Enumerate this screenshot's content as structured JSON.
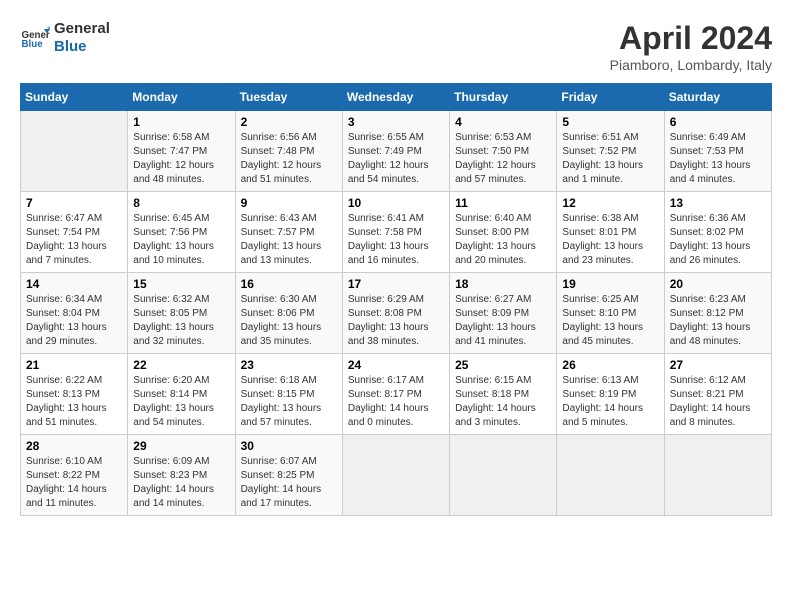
{
  "header": {
    "logo_line1": "General",
    "logo_line2": "Blue",
    "month_title": "April 2024",
    "location": "Piamboro, Lombardy, Italy"
  },
  "calendar": {
    "days_of_week": [
      "Sunday",
      "Monday",
      "Tuesday",
      "Wednesday",
      "Thursday",
      "Friday",
      "Saturday"
    ],
    "weeks": [
      [
        {
          "day": "",
          "info": ""
        },
        {
          "day": "1",
          "info": "Sunrise: 6:58 AM\nSunset: 7:47 PM\nDaylight: 12 hours\nand 48 minutes."
        },
        {
          "day": "2",
          "info": "Sunrise: 6:56 AM\nSunset: 7:48 PM\nDaylight: 12 hours\nand 51 minutes."
        },
        {
          "day": "3",
          "info": "Sunrise: 6:55 AM\nSunset: 7:49 PM\nDaylight: 12 hours\nand 54 minutes."
        },
        {
          "day": "4",
          "info": "Sunrise: 6:53 AM\nSunset: 7:50 PM\nDaylight: 12 hours\nand 57 minutes."
        },
        {
          "day": "5",
          "info": "Sunrise: 6:51 AM\nSunset: 7:52 PM\nDaylight: 13 hours\nand 1 minute."
        },
        {
          "day": "6",
          "info": "Sunrise: 6:49 AM\nSunset: 7:53 PM\nDaylight: 13 hours\nand 4 minutes."
        }
      ],
      [
        {
          "day": "7",
          "info": "Sunrise: 6:47 AM\nSunset: 7:54 PM\nDaylight: 13 hours\nand 7 minutes."
        },
        {
          "day": "8",
          "info": "Sunrise: 6:45 AM\nSunset: 7:56 PM\nDaylight: 13 hours\nand 10 minutes."
        },
        {
          "day": "9",
          "info": "Sunrise: 6:43 AM\nSunset: 7:57 PM\nDaylight: 13 hours\nand 13 minutes."
        },
        {
          "day": "10",
          "info": "Sunrise: 6:41 AM\nSunset: 7:58 PM\nDaylight: 13 hours\nand 16 minutes."
        },
        {
          "day": "11",
          "info": "Sunrise: 6:40 AM\nSunset: 8:00 PM\nDaylight: 13 hours\nand 20 minutes."
        },
        {
          "day": "12",
          "info": "Sunrise: 6:38 AM\nSunset: 8:01 PM\nDaylight: 13 hours\nand 23 minutes."
        },
        {
          "day": "13",
          "info": "Sunrise: 6:36 AM\nSunset: 8:02 PM\nDaylight: 13 hours\nand 26 minutes."
        }
      ],
      [
        {
          "day": "14",
          "info": "Sunrise: 6:34 AM\nSunset: 8:04 PM\nDaylight: 13 hours\nand 29 minutes."
        },
        {
          "day": "15",
          "info": "Sunrise: 6:32 AM\nSunset: 8:05 PM\nDaylight: 13 hours\nand 32 minutes."
        },
        {
          "day": "16",
          "info": "Sunrise: 6:30 AM\nSunset: 8:06 PM\nDaylight: 13 hours\nand 35 minutes."
        },
        {
          "day": "17",
          "info": "Sunrise: 6:29 AM\nSunset: 8:08 PM\nDaylight: 13 hours\nand 38 minutes."
        },
        {
          "day": "18",
          "info": "Sunrise: 6:27 AM\nSunset: 8:09 PM\nDaylight: 13 hours\nand 41 minutes."
        },
        {
          "day": "19",
          "info": "Sunrise: 6:25 AM\nSunset: 8:10 PM\nDaylight: 13 hours\nand 45 minutes."
        },
        {
          "day": "20",
          "info": "Sunrise: 6:23 AM\nSunset: 8:12 PM\nDaylight: 13 hours\nand 48 minutes."
        }
      ],
      [
        {
          "day": "21",
          "info": "Sunrise: 6:22 AM\nSunset: 8:13 PM\nDaylight: 13 hours\nand 51 minutes."
        },
        {
          "day": "22",
          "info": "Sunrise: 6:20 AM\nSunset: 8:14 PM\nDaylight: 13 hours\nand 54 minutes."
        },
        {
          "day": "23",
          "info": "Sunrise: 6:18 AM\nSunset: 8:15 PM\nDaylight: 13 hours\nand 57 minutes."
        },
        {
          "day": "24",
          "info": "Sunrise: 6:17 AM\nSunset: 8:17 PM\nDaylight: 14 hours\nand 0 minutes."
        },
        {
          "day": "25",
          "info": "Sunrise: 6:15 AM\nSunset: 8:18 PM\nDaylight: 14 hours\nand 3 minutes."
        },
        {
          "day": "26",
          "info": "Sunrise: 6:13 AM\nSunset: 8:19 PM\nDaylight: 14 hours\nand 5 minutes."
        },
        {
          "day": "27",
          "info": "Sunrise: 6:12 AM\nSunset: 8:21 PM\nDaylight: 14 hours\nand 8 minutes."
        }
      ],
      [
        {
          "day": "28",
          "info": "Sunrise: 6:10 AM\nSunset: 8:22 PM\nDaylight: 14 hours\nand 11 minutes."
        },
        {
          "day": "29",
          "info": "Sunrise: 6:09 AM\nSunset: 8:23 PM\nDaylight: 14 hours\nand 14 minutes."
        },
        {
          "day": "30",
          "info": "Sunrise: 6:07 AM\nSunset: 8:25 PM\nDaylight: 14 hours\nand 17 minutes."
        },
        {
          "day": "",
          "info": ""
        },
        {
          "day": "",
          "info": ""
        },
        {
          "day": "",
          "info": ""
        },
        {
          "day": "",
          "info": ""
        }
      ]
    ]
  }
}
